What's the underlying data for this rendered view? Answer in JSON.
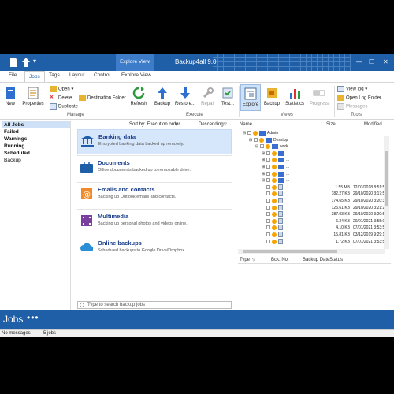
{
  "titlebar": {
    "app_title": "Backup4all 9.0",
    "context_tab": "Explore View",
    "minimize": "—",
    "maximize": "☐",
    "close": "✕"
  },
  "menu_tabs": [
    "File",
    "Jobs",
    "Tags",
    "Layout",
    "Control",
    "Explore View"
  ],
  "ribbon": {
    "manage": {
      "new": "New",
      "properties": "Properties",
      "open": "Open",
      "delete": "Delete",
      "duplicate": "Duplicate",
      "destination_folder": "Destination Folder",
      "refresh": "Refresh",
      "group": "Manage"
    },
    "execute": {
      "backup": "Backup",
      "restore": "Restore...",
      "repair": "Repair",
      "test": "Test...",
      "group": "Execute"
    },
    "views": {
      "explore": "Explore",
      "backup": "Backup",
      "statistics": "Statistics",
      "progress": "Progress",
      "group": "Views"
    },
    "tools": {
      "view_log": "View log",
      "open_log_folder": "Open Log Folder",
      "messages": "Messages",
      "group": "Tools"
    }
  },
  "left_filters": [
    {
      "label": "All Jobs",
      "bold": true,
      "selected": true
    },
    {
      "label": "Failed",
      "bold": true,
      "selected": false
    },
    {
      "label": "Warnings",
      "bold": true,
      "selected": false
    },
    {
      "label": "Running",
      "bold": true,
      "selected": false
    },
    {
      "label": "Scheduled",
      "bold": true,
      "selected": false
    },
    {
      "label": "Backup",
      "bold": false,
      "selected": false
    }
  ],
  "jobs_header": {
    "sort_label": "Sort by: Execution order",
    "direction": "Descending"
  },
  "jobs": [
    {
      "title": "Banking data",
      "desc": "Encrypted banking data backed up remotely.",
      "icon": "bank-icon",
      "selected": true
    },
    {
      "title": "Documents",
      "desc": "Office documents backed up to removable drive.",
      "icon": "briefcase-icon",
      "selected": false
    },
    {
      "title": "Emails and contacts",
      "desc": "Backing up Outlook emails and contacts.",
      "icon": "at-sign-icon",
      "selected": false
    },
    {
      "title": "Multimedia",
      "desc": "Backing up personal photos and videos online.",
      "icon": "film-icon",
      "selected": false
    },
    {
      "title": "Online backups",
      "desc": "Scheduled backups to Google Drive/Dropbox.",
      "icon": "cloud-icon",
      "selected": false
    }
  ],
  "search_placeholder": "Type to search backup jobs",
  "explorer": {
    "columns": {
      "name": "Name",
      "size": "Size",
      "modified": "Modified"
    },
    "tree": [
      {
        "label": "Admin",
        "size": "",
        "modified": "",
        "indent": 1,
        "kind": "folder"
      },
      {
        "label": "Desktop",
        "size": "",
        "modified": "",
        "indent": 2,
        "kind": "folder"
      },
      {
        "label": "work",
        "size": "",
        "modified": "",
        "indent": 3,
        "kind": "folder"
      },
      {
        "label": "...",
        "size": "",
        "modified": "",
        "indent": 4,
        "kind": "folder"
      },
      {
        "label": "...",
        "size": "",
        "modified": "",
        "indent": 4,
        "kind": "folder"
      },
      {
        "label": "...",
        "size": "",
        "modified": "",
        "indent": 4,
        "kind": "folder"
      },
      {
        "label": "...",
        "size": "",
        "modified": "",
        "indent": 4,
        "kind": "folder"
      },
      {
        "label": "...",
        "size": "",
        "modified": "",
        "indent": 4,
        "kind": "folder"
      },
      {
        "label": "",
        "size": "1.55 MB",
        "modified": "12/03/2018 8:51:58",
        "indent": 4,
        "kind": "file"
      },
      {
        "label": "",
        "size": "182.27 KB",
        "modified": "29/10/2020 3:17:51",
        "indent": 4,
        "kind": "file"
      },
      {
        "label": "",
        "size": "174.65 KB",
        "modified": "29/10/2020 3:20:39",
        "indent": 4,
        "kind": "file"
      },
      {
        "label": "",
        "size": "125.61 KB",
        "modified": "29/10/2020 3:21:28",
        "indent": 4,
        "kind": "file"
      },
      {
        "label": "",
        "size": "387.03 KB",
        "modified": "29/10/2020 3:20:57",
        "indent": 4,
        "kind": "file"
      },
      {
        "label": "",
        "size": "6.34 KB",
        "modified": "20/01/2021 3:55:09",
        "indent": 4,
        "kind": "file"
      },
      {
        "label": "",
        "size": "4.10 KB",
        "modified": "07/01/2021 3:53:59",
        "indent": 4,
        "kind": "file"
      },
      {
        "label": "",
        "size": "15.81 KB",
        "modified": "03/12/2019 9:29:12",
        "indent": 4,
        "kind": "file"
      },
      {
        "label": "",
        "size": "1.72 KB",
        "modified": "07/01/2021 3:53:59",
        "indent": 4,
        "kind": "file"
      }
    ],
    "bottom_columns": {
      "type": "Type",
      "bck_no": "Bck. No.",
      "backup_date": "Backup Date",
      "status": "Status"
    }
  },
  "jobs_bar": {
    "title": "Jobs",
    "more": "•••"
  },
  "status_bar": {
    "messages": "No messages",
    "count": "5 jobs"
  },
  "colors": {
    "accent": "#1f5fa8",
    "selection": "#cfe1f7",
    "status_orange": "#f7a400"
  }
}
